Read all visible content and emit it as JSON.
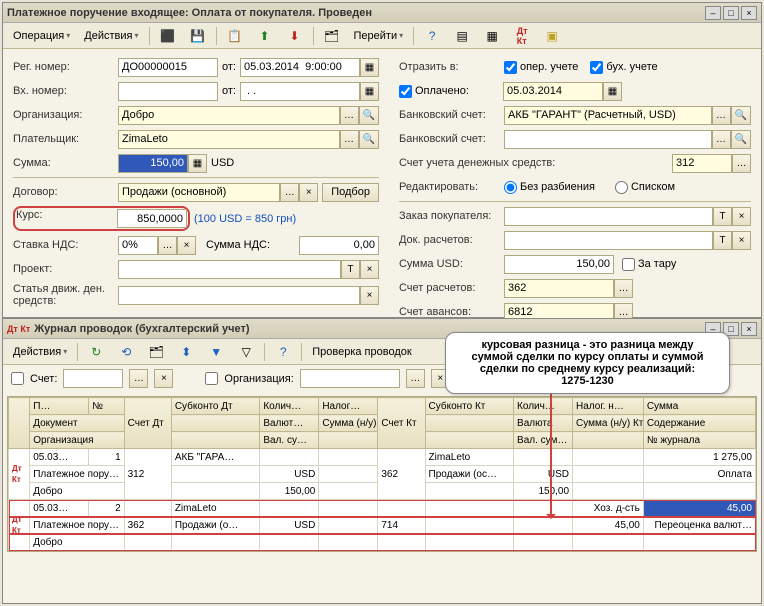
{
  "window1": {
    "title": "Платежное поручение входящее: Оплата от покупателя. Проведен",
    "toolbar": {
      "operation": "Операция",
      "actions": "Действия",
      "goto": "Перейти"
    },
    "left": {
      "reg_no_label": "Рег. номер:",
      "reg_no": "ДО00000015",
      "from_label": "от:",
      "from_date": "05.03.2014  9:00:00",
      "in_no_label": "Вх. номер:",
      "in_no": "",
      "in_from": " . .",
      "org_label": "Организация:",
      "org": "Добро",
      "payer_label": "Плательщик:",
      "payer": "ZimaLeto",
      "sum_label": "Сумма:",
      "sum": "150,00",
      "currency": "USD",
      "contract_label": "Договор:",
      "contract": "Продажи (основной)",
      "podbor": "Подбор",
      "rate_label": "Курс:",
      "rate": "850,0000",
      "rate_hint": "(100 USD = 850 грн)",
      "vat_label": "Ставка НДС:",
      "vat": "0%",
      "vat_sum_label": "Сумма НДС:",
      "vat_sum": "0,00",
      "project_label": "Проект:",
      "cashflow_label": "Статья движ. ден. средств:"
    },
    "right": {
      "reflect_label": "Отразить в:",
      "oper_uchet": "опер. учете",
      "bukh_uchet": "бух. учете",
      "paid_label": "Оплачено:",
      "paid_date": "05.03.2014",
      "bank_acc_label": "Банковский счет:",
      "bank_acc": "АКБ \"ГАРАНТ\" (Расчетный, USD)",
      "bank_acc2_label": "Банковский счет:",
      "cash_acc_label": "Счет учета денежных средств:",
      "cash_acc": "312",
      "edit_label": "Редактировать:",
      "edit_no_split": "Без разбиения",
      "edit_list": "Списком",
      "order_label": "Заказ покупателя:",
      "doc_calc_label": "Док. расчетов:",
      "sum_usd_label": "Сумма USD:",
      "sum_usd": "150,00",
      "za_taru": "За тару",
      "calc_acc_label": "Счет расчетов:",
      "calc_acc": "362",
      "advance_acc_label": "Счет авансов:",
      "advance_acc": "6812"
    }
  },
  "window2": {
    "title": "Журнал проводок (бухгалтерский учет)",
    "toolbar": {
      "actions": "Действия",
      "check": "Проверка проводок"
    },
    "filter": {
      "account_label": "Счет:",
      "org_label": "Организация:"
    },
    "headers": {
      "r1": [
        "П…",
        "№",
        "Счет Дт",
        "Субконто Дт",
        "Колич…",
        "Налог…",
        "Счет Кт",
        "Субконто Кт",
        "Колич…",
        "Налог. н…",
        "Сумма"
      ],
      "r2": [
        "Документ",
        "",
        "",
        "",
        "Валют…",
        "Сумма (н/у)…",
        "",
        "",
        "Валюта",
        "Сумма (н/у) Кт",
        "Содержание"
      ],
      "r3": [
        "Организация",
        "",
        "",
        "",
        "Вал. су…",
        "",
        "",
        "",
        "Вал. сум…",
        "",
        "№ журнала"
      ]
    },
    "rows": [
      {
        "r1": [
          "05.03…",
          "1",
          "312",
          "АКБ \"ГАРА…",
          "",
          "",
          "362",
          "ZimaLeto",
          "",
          "",
          "1 275,00"
        ],
        "r2": [
          "Платежное пору…",
          "",
          "",
          "",
          "USD",
          "",
          "",
          "Продажи (ос…",
          "USD",
          "",
          "Оплата"
        ],
        "r3": [
          "Добро",
          "",
          "",
          "",
          "150,00",
          "",
          "",
          "",
          "150,00",
          "",
          ""
        ]
      },
      {
        "r1": [
          "05.03…",
          "2",
          "362",
          "ZimaLeto",
          "",
          "",
          "714",
          "",
          "",
          "Хоз. д-сть",
          "45,00"
        ],
        "r2": [
          "Платежное пору…",
          "",
          "",
          "Продажи (о…",
          "USD",
          "",
          "",
          "",
          "",
          "45,00",
          "Переоценка валют…"
        ],
        "r3": [
          "Добро",
          "",
          "",
          "",
          "",
          "",
          "",
          "",
          "",
          "",
          ""
        ]
      }
    ]
  },
  "callout": {
    "line1": "курсовая разница - это разница между",
    "line2": "суммой сделки по курсу оплаты и суммой",
    "line3": "сделки по среднему курсу реализаций:",
    "line4": "1275-1230"
  }
}
